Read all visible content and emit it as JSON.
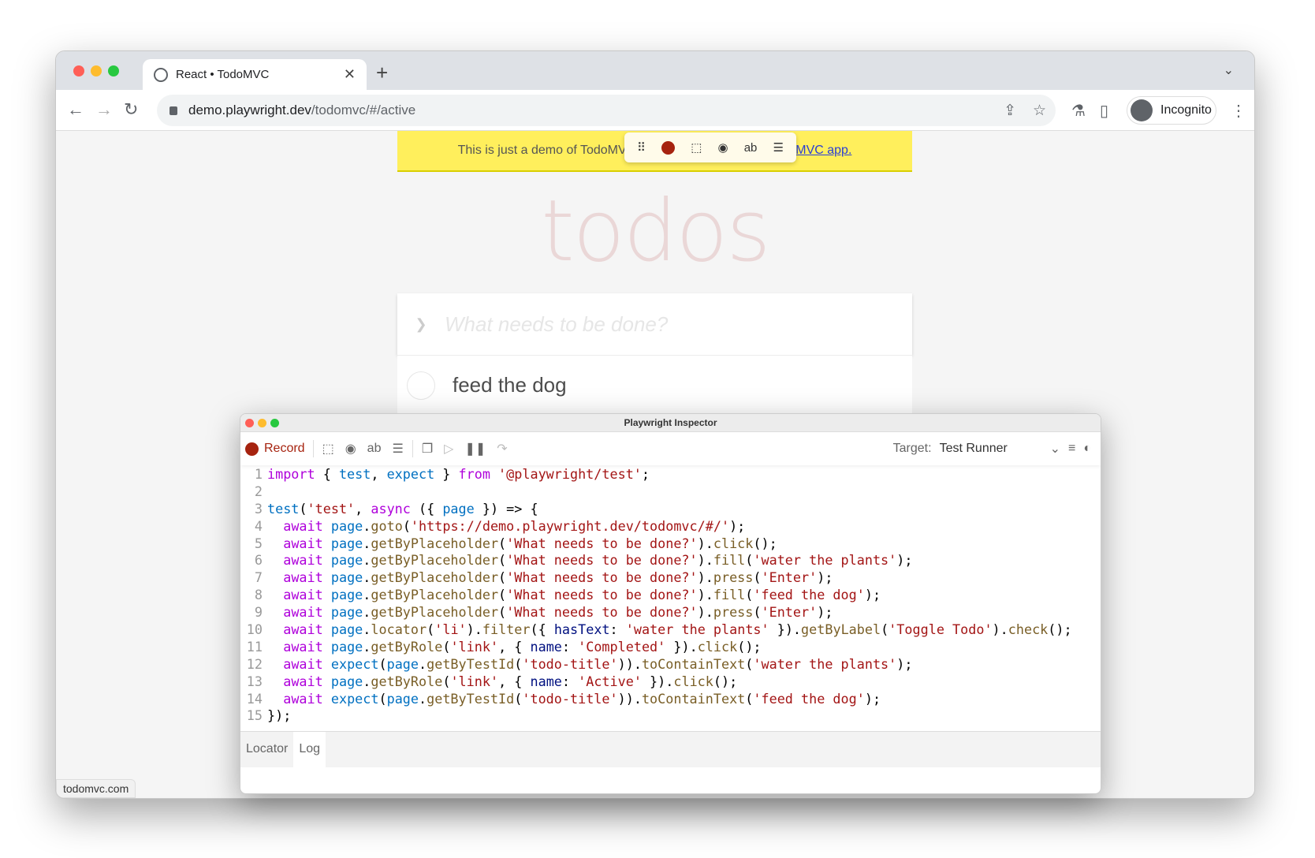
{
  "browser": {
    "tab_title": "React • TodoMVC",
    "url_host": "demo.playwright.dev",
    "url_path": "/todomvc/#/active",
    "profile": "Incognito",
    "status_url": "todomvc.com"
  },
  "page": {
    "banner_text": "This is just a demo of TodoMVC for testing, not the",
    "banner_link": "real TodoMVC app.",
    "heading": "todos",
    "new_todo_placeholder": "What needs to be done?",
    "todos": [
      "feed the dog"
    ]
  },
  "inspector": {
    "title": "Playwright Inspector",
    "record_label": "Record",
    "target_label": "Target:",
    "target_value": "Test Runner",
    "bottom_tabs": [
      "Locator",
      "Log"
    ],
    "active_bottom_tab": "Log",
    "colors": {
      "keyword": "#af00db",
      "variable": "#0070c1",
      "string": "#a31515",
      "function": "#795e26",
      "record": "#a6230f"
    },
    "code": [
      [
        [
          "k",
          "import"
        ],
        [
          "p",
          " { "
        ],
        [
          "v",
          "test"
        ],
        [
          "p",
          ", "
        ],
        [
          "v",
          "expect"
        ],
        [
          "p",
          " } "
        ],
        [
          "k",
          "from"
        ],
        [
          "p",
          " "
        ],
        [
          "s",
          "'@playwright/test'"
        ],
        [
          "p",
          ";"
        ]
      ],
      [],
      [
        [
          "v",
          "test"
        ],
        [
          "p",
          "("
        ],
        [
          "s",
          "'test'"
        ],
        [
          "p",
          ", "
        ],
        [
          "k",
          "async"
        ],
        [
          "p",
          " ({ "
        ],
        [
          "v",
          "page"
        ],
        [
          "p",
          " }) => {"
        ]
      ],
      [
        [
          "p",
          "  "
        ],
        [
          "k",
          "await"
        ],
        [
          "p",
          " "
        ],
        [
          "v",
          "page"
        ],
        [
          "p",
          "."
        ],
        [
          "f",
          "goto"
        ],
        [
          "p",
          "("
        ],
        [
          "s",
          "'https://demo.playwright.dev/todomvc/#/'"
        ],
        [
          "p",
          ");"
        ]
      ],
      [
        [
          "p",
          "  "
        ],
        [
          "k",
          "await"
        ],
        [
          "p",
          " "
        ],
        [
          "v",
          "page"
        ],
        [
          "p",
          "."
        ],
        [
          "f",
          "getByPlaceholder"
        ],
        [
          "p",
          "("
        ],
        [
          "s",
          "'What needs to be done?'"
        ],
        [
          "p",
          ")."
        ],
        [
          "f",
          "click"
        ],
        [
          "p",
          "();"
        ]
      ],
      [
        [
          "p",
          "  "
        ],
        [
          "k",
          "await"
        ],
        [
          "p",
          " "
        ],
        [
          "v",
          "page"
        ],
        [
          "p",
          "."
        ],
        [
          "f",
          "getByPlaceholder"
        ],
        [
          "p",
          "("
        ],
        [
          "s",
          "'What needs to be done?'"
        ],
        [
          "p",
          ")."
        ],
        [
          "f",
          "fill"
        ],
        [
          "p",
          "("
        ],
        [
          "s",
          "'water the plants'"
        ],
        [
          "p",
          ");"
        ]
      ],
      [
        [
          "p",
          "  "
        ],
        [
          "k",
          "await"
        ],
        [
          "p",
          " "
        ],
        [
          "v",
          "page"
        ],
        [
          "p",
          "."
        ],
        [
          "f",
          "getByPlaceholder"
        ],
        [
          "p",
          "("
        ],
        [
          "s",
          "'What needs to be done?'"
        ],
        [
          "p",
          ")."
        ],
        [
          "f",
          "press"
        ],
        [
          "p",
          "("
        ],
        [
          "s",
          "'Enter'"
        ],
        [
          "p",
          ");"
        ]
      ],
      [
        [
          "p",
          "  "
        ],
        [
          "k",
          "await"
        ],
        [
          "p",
          " "
        ],
        [
          "v",
          "page"
        ],
        [
          "p",
          "."
        ],
        [
          "f",
          "getByPlaceholder"
        ],
        [
          "p",
          "("
        ],
        [
          "s",
          "'What needs to be done?'"
        ],
        [
          "p",
          ")."
        ],
        [
          "f",
          "fill"
        ],
        [
          "p",
          "("
        ],
        [
          "s",
          "'feed the dog'"
        ],
        [
          "p",
          ");"
        ]
      ],
      [
        [
          "p",
          "  "
        ],
        [
          "k",
          "await"
        ],
        [
          "p",
          " "
        ],
        [
          "v",
          "page"
        ],
        [
          "p",
          "."
        ],
        [
          "f",
          "getByPlaceholder"
        ],
        [
          "p",
          "("
        ],
        [
          "s",
          "'What needs to be done?'"
        ],
        [
          "p",
          ")."
        ],
        [
          "f",
          "press"
        ],
        [
          "p",
          "("
        ],
        [
          "s",
          "'Enter'"
        ],
        [
          "p",
          ");"
        ]
      ],
      [
        [
          "p",
          "  "
        ],
        [
          "k",
          "await"
        ],
        [
          "p",
          " "
        ],
        [
          "v",
          "page"
        ],
        [
          "p",
          "."
        ],
        [
          "f",
          "locator"
        ],
        [
          "p",
          "("
        ],
        [
          "s",
          "'li'"
        ],
        [
          "p",
          ")."
        ],
        [
          "f",
          "filter"
        ],
        [
          "p",
          "({ "
        ],
        [
          "pr",
          "hasText"
        ],
        [
          "p",
          ": "
        ],
        [
          "s",
          "'water the plants'"
        ],
        [
          "p",
          " })."
        ],
        [
          "f",
          "getByLabel"
        ],
        [
          "p",
          "("
        ],
        [
          "s",
          "'Toggle Todo'"
        ],
        [
          "p",
          ")."
        ],
        [
          "f",
          "check"
        ],
        [
          "p",
          "();"
        ]
      ],
      [
        [
          "p",
          "  "
        ],
        [
          "k",
          "await"
        ],
        [
          "p",
          " "
        ],
        [
          "v",
          "page"
        ],
        [
          "p",
          "."
        ],
        [
          "f",
          "getByRole"
        ],
        [
          "p",
          "("
        ],
        [
          "s",
          "'link'"
        ],
        [
          "p",
          ", { "
        ],
        [
          "pr",
          "name"
        ],
        [
          "p",
          ": "
        ],
        [
          "s",
          "'Completed'"
        ],
        [
          "p",
          " })."
        ],
        [
          "f",
          "click"
        ],
        [
          "p",
          "();"
        ]
      ],
      [
        [
          "p",
          "  "
        ],
        [
          "k",
          "await"
        ],
        [
          "p",
          " "
        ],
        [
          "v",
          "expect"
        ],
        [
          "p",
          "("
        ],
        [
          "v",
          "page"
        ],
        [
          "p",
          "."
        ],
        [
          "f",
          "getByTestId"
        ],
        [
          "p",
          "("
        ],
        [
          "s",
          "'todo-title'"
        ],
        [
          "p",
          "))."
        ],
        [
          "f",
          "toContainText"
        ],
        [
          "p",
          "("
        ],
        [
          "s",
          "'water the plants'"
        ],
        [
          "p",
          ");"
        ]
      ],
      [
        [
          "p",
          "  "
        ],
        [
          "k",
          "await"
        ],
        [
          "p",
          " "
        ],
        [
          "v",
          "page"
        ],
        [
          "p",
          "."
        ],
        [
          "f",
          "getByRole"
        ],
        [
          "p",
          "("
        ],
        [
          "s",
          "'link'"
        ],
        [
          "p",
          ", { "
        ],
        [
          "pr",
          "name"
        ],
        [
          "p",
          ": "
        ],
        [
          "s",
          "'Active'"
        ],
        [
          "p",
          " })."
        ],
        [
          "f",
          "click"
        ],
        [
          "p",
          "();"
        ]
      ],
      [
        [
          "p",
          "  "
        ],
        [
          "k",
          "await"
        ],
        [
          "p",
          " "
        ],
        [
          "v",
          "expect"
        ],
        [
          "p",
          "("
        ],
        [
          "v",
          "page"
        ],
        [
          "p",
          "."
        ],
        [
          "f",
          "getByTestId"
        ],
        [
          "p",
          "("
        ],
        [
          "s",
          "'todo-title'"
        ],
        [
          "p",
          "))."
        ],
        [
          "f",
          "toContainText"
        ],
        [
          "p",
          "("
        ],
        [
          "s",
          "'feed the dog'"
        ],
        [
          "p",
          ");"
        ]
      ],
      [
        [
          "p",
          "});"
        ]
      ]
    ]
  }
}
